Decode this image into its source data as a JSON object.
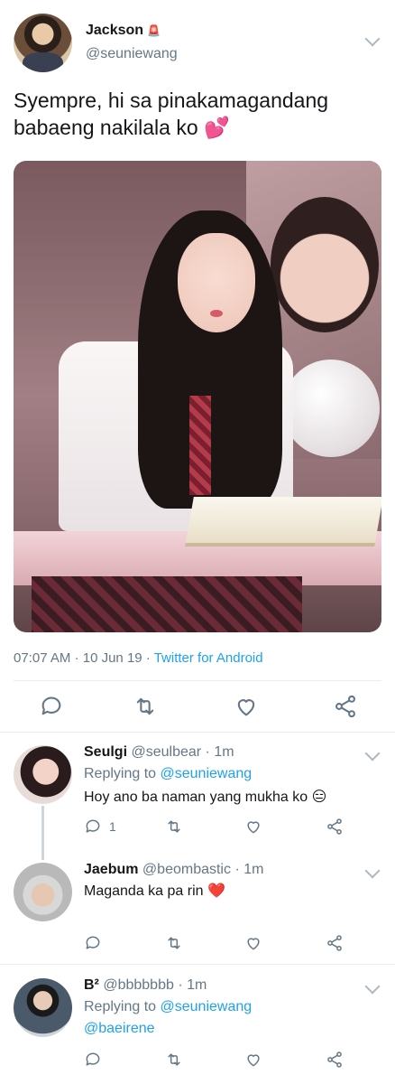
{
  "tweet": {
    "author_name": "Jackson",
    "author_badge_icon": "siren-emoji",
    "author_handle": "@seuniewang",
    "text": "Syempre, hi sa pinakamagandang babaeng nakilala ko",
    "text_emoji": "💕",
    "time": "07:07 AM",
    "date": "10 Jun 19",
    "source": "Twitter for Android",
    "meta_separator": "·"
  },
  "replies": [
    {
      "name": "Seulgi",
      "handle": "@seulbear",
      "age": "· 1m",
      "replying_label": "Replying to",
      "replying_to": "@seuniewang",
      "text": "Hoy ano ba naman yang mukha ko",
      "emoji": "😑",
      "reply_count": "1"
    },
    {
      "name": "Jaebum",
      "handle": "@beombastic",
      "age": "· 1m",
      "text": "Maganda ka pa rin",
      "emoji": "❤️",
      "reply_count": ""
    },
    {
      "name": "B²",
      "handle": "@bbbbbbb",
      "age": "· 1m",
      "replying_label": "Replying to",
      "replying_to": "@seuniewang",
      "text": "@baeirene",
      "reply_count": ""
    }
  ],
  "icons": {
    "reply": "comment-icon",
    "retweet": "retweet-icon",
    "like": "heart-icon",
    "share": "share-icon",
    "menu": "chevron-down-icon"
  },
  "colors": {
    "link": "#1da1f2",
    "muted": "#657786",
    "text": "#14171a"
  }
}
